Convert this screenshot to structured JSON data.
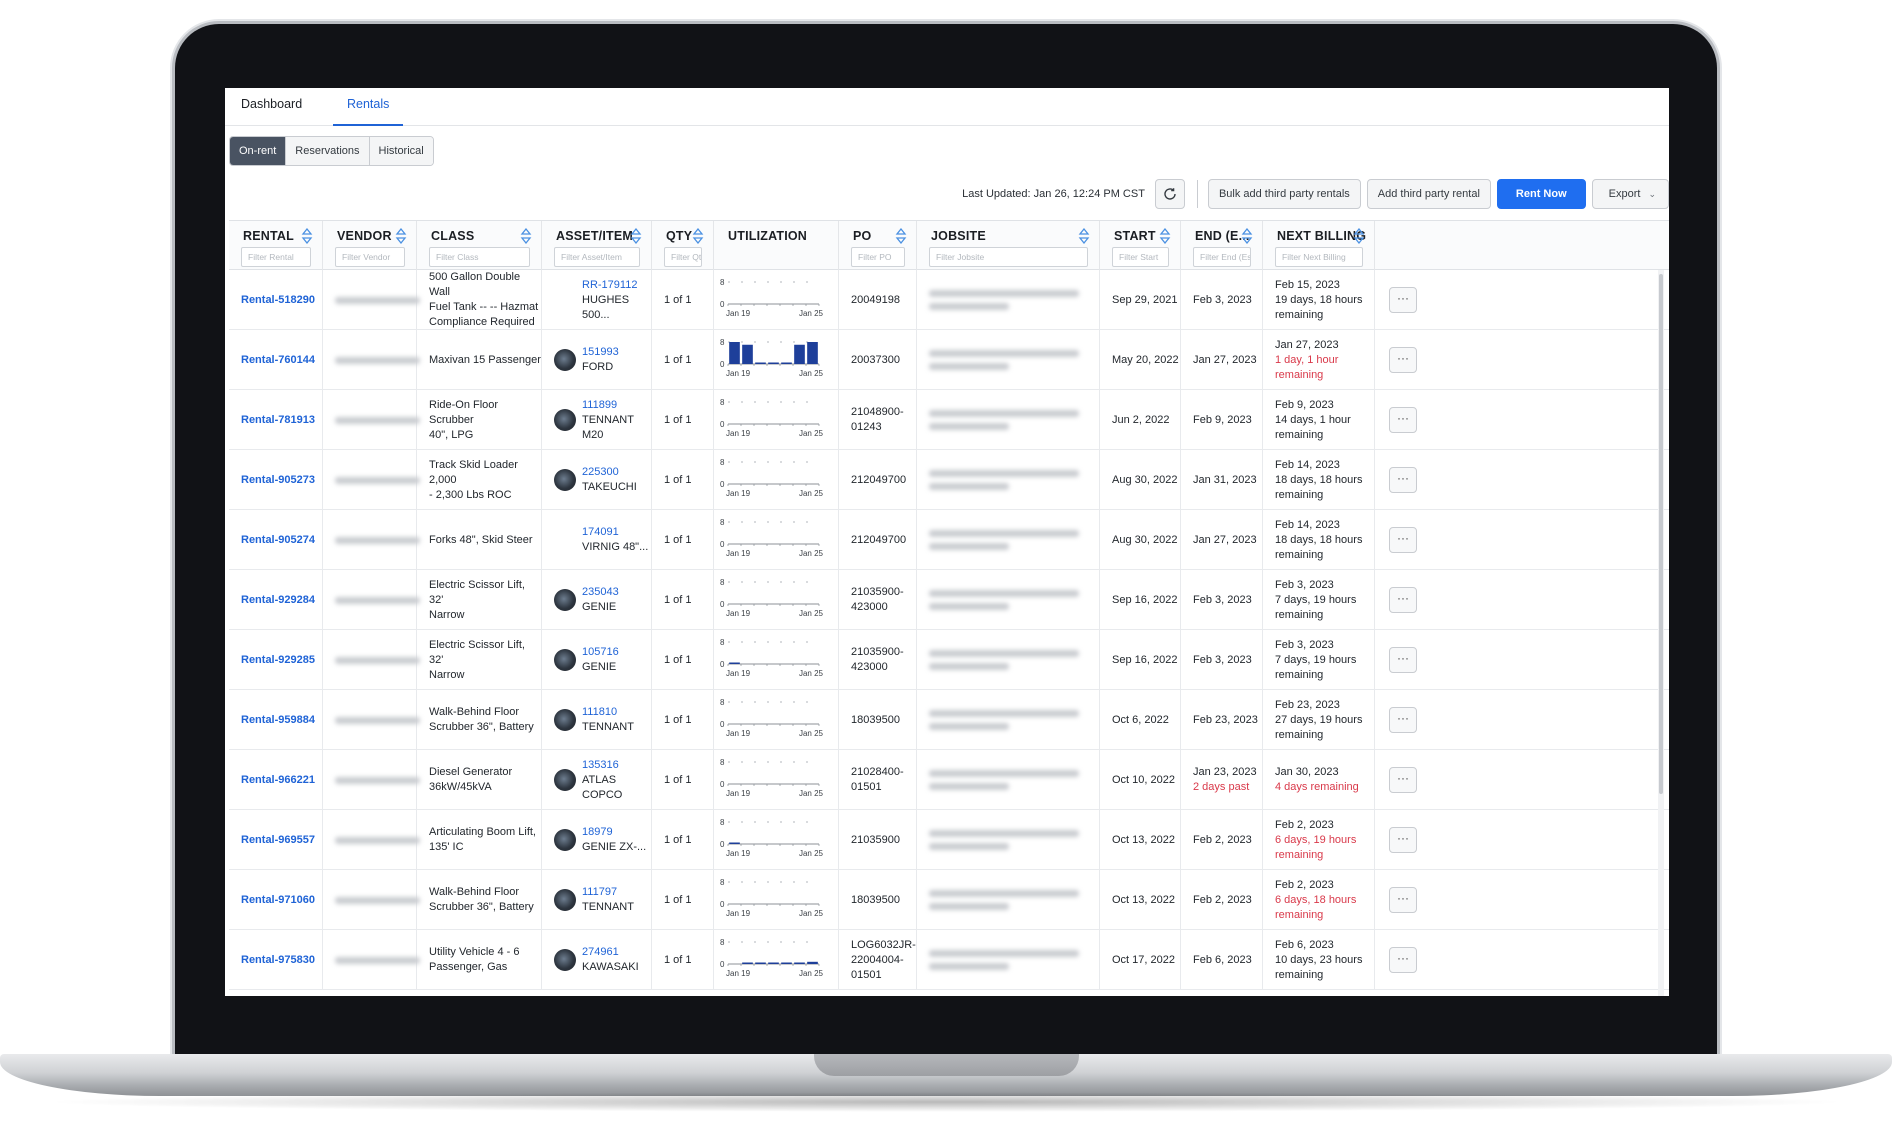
{
  "tabs": [
    {
      "label": "Dashboard",
      "active": false
    },
    {
      "label": "Rentals",
      "active": true
    }
  ],
  "segments": [
    {
      "label": "On-rent",
      "active": true
    },
    {
      "label": "Reservations",
      "active": false
    },
    {
      "label": "Historical",
      "active": false
    }
  ],
  "toolbar": {
    "last_updated": "Last Updated: Jan 26, 12:24 PM CST",
    "refresh_icon": "refresh-icon",
    "bulk_add_label": "Bulk add third party rentals",
    "add_third_party_label": "Add third party rental",
    "rent_now_label": "Rent Now",
    "export_label": "Export",
    "primary_color": "#1f6ef0"
  },
  "columns": [
    {
      "key": "rental",
      "label": "RENTAL",
      "filter": "Filter Rental",
      "sortable": true
    },
    {
      "key": "vendor",
      "label": "VENDOR",
      "filter": "Filter Vendor",
      "sortable": true
    },
    {
      "key": "class",
      "label": "CLASS",
      "filter": "Filter Class",
      "sortable": true
    },
    {
      "key": "asset",
      "label": "ASSET/ITEM",
      "filter": "Filter Asset/Item",
      "sortable": true
    },
    {
      "key": "qty",
      "label": "QTY",
      "filter": "Filter Qty",
      "sortable": true
    },
    {
      "key": "utilization",
      "label": "UTILIZATION",
      "filter": "",
      "sortable": false
    },
    {
      "key": "po",
      "label": "PO",
      "filter": "Filter PO",
      "sortable": true
    },
    {
      "key": "jobsite",
      "label": "JOBSITE",
      "filter": "Filter Jobsite",
      "sortable": true
    },
    {
      "key": "start",
      "label": "START",
      "filter": "Filter Start",
      "sortable": true
    },
    {
      "key": "end",
      "label": "END (E...",
      "filter": "Filter End (Est.)",
      "sortable": true
    },
    {
      "key": "next_billing",
      "label": "NEXT BILLING",
      "filter": "Filter Next Billing",
      "sortable": true
    },
    {
      "key": "actions",
      "label": "",
      "filter": "",
      "sortable": false
    }
  ],
  "utilization_axis": {
    "y_max": "8",
    "y_min": "0",
    "x_start": "Jan 19",
    "x_end": "Jan 25"
  },
  "rows": [
    {
      "rental": "Rental-518290",
      "class": [
        "500 Gallon Double Wall",
        "Fuel Tank -- -- Hazmat",
        "Compliance Required"
      ],
      "asset_id": "RR-179112",
      "asset_name": "HUGHES 500...",
      "thumb": false,
      "qty": "1 of 1",
      "util": [
        0,
        0,
        0,
        0,
        0,
        0,
        0
      ],
      "po": [
        "20049198"
      ],
      "start": "Sep 29, 2021",
      "end": "Feb 3, 2023",
      "end_note": "",
      "billing_date": "Feb 15, 2023",
      "billing_remaining": [
        "19 days, 18 hours",
        "remaining"
      ],
      "billing_red": false
    },
    {
      "rental": "Rental-760144",
      "class": [
        "Maxivan 15 Passenger"
      ],
      "asset_id": "151993",
      "asset_name": "FORD",
      "thumb": true,
      "qty": "1 of 1",
      "util": [
        8,
        7,
        0.5,
        0.3,
        0.3,
        7,
        8
      ],
      "po": [
        "20037300"
      ],
      "start": "May 20, 2022",
      "end": "Jan 27, 2023",
      "end_note": "",
      "billing_date": "Jan 27, 2023",
      "billing_remaining": [
        "1 day, 1 hour",
        "remaining"
      ],
      "billing_red": true
    },
    {
      "rental": "Rental-781913",
      "class": [
        "Ride-On Floor Scrubber",
        "40\", LPG"
      ],
      "asset_id": "111899",
      "asset_name": "TENNANT M20",
      "thumb": true,
      "qty": "1 of 1",
      "util": [
        0,
        0,
        0,
        0,
        0,
        0,
        0
      ],
      "po": [
        "21048900-",
        "01243"
      ],
      "start": "Jun 2, 2022",
      "end": "Feb 9, 2023",
      "end_note": "",
      "billing_date": "Feb 9, 2023",
      "billing_remaining": [
        "14 days, 1 hour",
        "remaining"
      ],
      "billing_red": false
    },
    {
      "rental": "Rental-905273",
      "class": [
        "Track Skid Loader 2,000",
        "- 2,300 Lbs ROC"
      ],
      "asset_id": "225300",
      "asset_name": "TAKEUCHI",
      "thumb": true,
      "qty": "1 of 1",
      "util": [
        0,
        0,
        0,
        0,
        0,
        0,
        0
      ],
      "po": [
        "212049700"
      ],
      "start": "Aug 30, 2022",
      "end": "Jan 31, 2023",
      "end_note": "",
      "billing_date": "Feb 14, 2023",
      "billing_remaining": [
        "18 days, 18 hours",
        "remaining"
      ],
      "billing_red": false
    },
    {
      "rental": "Rental-905274",
      "class": [
        "Forks 48\", Skid Steer"
      ],
      "asset_id": "174091",
      "asset_name": "VIRNIG 48\"...",
      "thumb": false,
      "qty": "1 of 1",
      "util": [
        0,
        0,
        0,
        0,
        0,
        0,
        0
      ],
      "po": [
        "212049700"
      ],
      "start": "Aug 30, 2022",
      "end": "Jan 27, 2023",
      "end_note": "",
      "billing_date": "Feb 14, 2023",
      "billing_remaining": [
        "18 days, 18 hours",
        "remaining"
      ],
      "billing_red": false
    },
    {
      "rental": "Rental-929284",
      "class": [
        "Electric Scissor Lift, 32'",
        "Narrow"
      ],
      "asset_id": "235043",
      "asset_name": "GENIE",
      "thumb": true,
      "qty": "1 of 1",
      "util": [
        0,
        0,
        0,
        0,
        0,
        0,
        0
      ],
      "po": [
        "21035900-",
        "423000"
      ],
      "start": "Sep 16, 2022",
      "end": "Feb 3, 2023",
      "end_note": "",
      "billing_date": "Feb 3, 2023",
      "billing_remaining": [
        "7 days, 19 hours",
        "remaining"
      ],
      "billing_red": false
    },
    {
      "rental": "Rental-929285",
      "class": [
        "Electric Scissor Lift, 32'",
        "Narrow"
      ],
      "asset_id": "105716",
      "asset_name": "GENIE",
      "thumb": true,
      "qty": "1 of 1",
      "util": [
        0.4,
        0,
        0,
        0,
        0,
        0,
        0
      ],
      "po": [
        "21035900-",
        "423000"
      ],
      "start": "Sep 16, 2022",
      "end": "Feb 3, 2023",
      "end_note": "",
      "billing_date": "Feb 3, 2023",
      "billing_remaining": [
        "7 days, 19 hours",
        "remaining"
      ],
      "billing_red": false
    },
    {
      "rental": "Rental-959884",
      "class": [
        "Walk-Behind Floor",
        "Scrubber 36\", Battery"
      ],
      "asset_id": "111810",
      "asset_name": "TENNANT",
      "thumb": true,
      "qty": "1 of 1",
      "util": [
        0,
        0,
        0,
        0,
        0,
        0,
        0
      ],
      "po": [
        "18039500"
      ],
      "start": "Oct 6, 2022",
      "end": "Feb 23, 2023",
      "end_note": "",
      "billing_date": "Feb 23, 2023",
      "billing_remaining": [
        "27 days, 19 hours",
        "remaining"
      ],
      "billing_red": false
    },
    {
      "rental": "Rental-966221",
      "class": [
        "Diesel Generator",
        "36kW/45kVA"
      ],
      "asset_id": "135316",
      "asset_name": "ATLAS COPCO",
      "thumb": true,
      "qty": "1 of 1",
      "util": [
        0,
        0,
        0,
        0,
        0,
        0,
        0
      ],
      "po": [
        "21028400-",
        "01501"
      ],
      "start": "Oct 10, 2022",
      "end": "Jan 23, 2023",
      "end_note": "2 days past",
      "billing_date": "Jan 30, 2023",
      "billing_remaining": [
        "4 days remaining"
      ],
      "billing_red": true
    },
    {
      "rental": "Rental-969557",
      "class": [
        "Articulating Boom Lift,",
        "135' IC"
      ],
      "asset_id": "18979",
      "asset_name": "GENIE ZX-...",
      "thumb": true,
      "qty": "1 of 1",
      "util": [
        0.5,
        0,
        0,
        0,
        0,
        0,
        0
      ],
      "po": [
        "21035900"
      ],
      "start": "Oct 13, 2022",
      "end": "Feb 2, 2023",
      "end_note": "",
      "billing_date": "Feb 2, 2023",
      "billing_remaining": [
        "6 days, 19 hours",
        "remaining"
      ],
      "billing_red": true
    },
    {
      "rental": "Rental-971060",
      "class": [
        "Walk-Behind Floor",
        "Scrubber 36\", Battery"
      ],
      "asset_id": "111797",
      "asset_name": "TENNANT",
      "thumb": true,
      "qty": "1 of 1",
      "util": [
        0,
        0,
        0,
        0,
        0,
        0,
        0
      ],
      "po": [
        "18039500"
      ],
      "start": "Oct 13, 2022",
      "end": "Feb 2, 2023",
      "end_note": "",
      "billing_date": "Feb 2, 2023",
      "billing_remaining": [
        "6 days, 18 hours",
        "remaining"
      ],
      "billing_red": true
    },
    {
      "rental": "Rental-975830",
      "class": [
        "Utility Vehicle 4 - 6",
        "Passenger, Gas"
      ],
      "asset_id": "274961",
      "asset_name": "KAWASAKI",
      "thumb": true,
      "qty": "1 of 1",
      "util": [
        0,
        0.3,
        0.5,
        0.3,
        0.3,
        0.3,
        0.8
      ],
      "po": [
        "LOG6032JR-",
        "22004004-",
        "01501"
      ],
      "start": "Oct 17, 2022",
      "end": "Feb 6, 2023",
      "end_note": "",
      "billing_date": "Feb 6, 2023",
      "billing_remaining": [
        "10 days, 23 hours",
        "remaining"
      ],
      "billing_red": false
    }
  ],
  "more_button_label": "···",
  "colors": {
    "link": "#1f63d6",
    "warning": "#d9394a",
    "bar": "#1e3f9a"
  }
}
